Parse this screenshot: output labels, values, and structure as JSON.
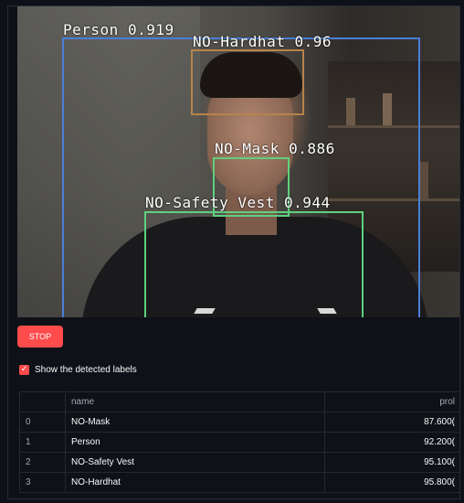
{
  "detections": {
    "person": {
      "label": "Person",
      "score": "0.919"
    },
    "hardhat": {
      "label": "NO-Hardhat",
      "score": "0.96"
    },
    "mask": {
      "label": "NO-Mask",
      "score": "0.886"
    },
    "vest": {
      "label": "NO-Safety Vest",
      "score": "0.944"
    },
    "colors": {
      "person": "#4a7fd6",
      "hardhat": "#b7834a",
      "mask": "#5fd07e",
      "vest": "#5fd07e"
    }
  },
  "controls": {
    "stop_label": "STOP",
    "checkbox_label": "Show the detected labels",
    "checkbox_checked": true,
    "accent": "#ff4b4b"
  },
  "table": {
    "columns": [
      "",
      "name",
      "prol"
    ],
    "rows": [
      {
        "index": "0",
        "name": "NO-Mask",
        "prob": "87.600("
      },
      {
        "index": "1",
        "name": "Person",
        "prob": "92.200("
      },
      {
        "index": "2",
        "name": "NO-Safety Vest",
        "prob": "95.100("
      },
      {
        "index": "3",
        "name": "NO-Hardhat",
        "prob": "95.800("
      }
    ]
  }
}
